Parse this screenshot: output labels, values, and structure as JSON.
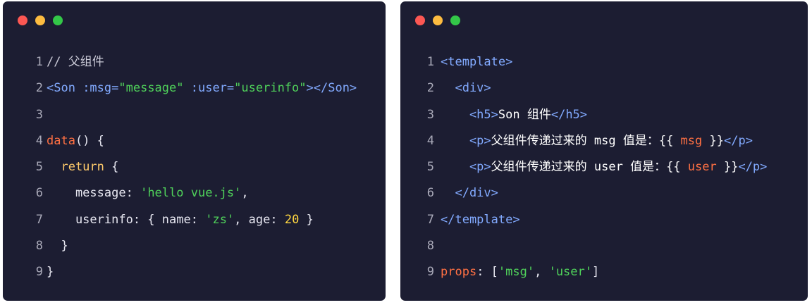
{
  "left_window": {
    "lines": [
      {
        "n": "1",
        "tokens": [
          {
            "t": "// 父组件",
            "c": "c-comment"
          }
        ]
      },
      {
        "n": "2",
        "tokens": [
          {
            "t": "<Son",
            "c": "c-tag"
          },
          {
            "t": " :msg=",
            "c": "c-attr"
          },
          {
            "t": "\"message\"",
            "c": "c-str"
          },
          {
            "t": " :user=",
            "c": "c-attr"
          },
          {
            "t": "\"userinfo\"",
            "c": "c-str"
          },
          {
            "t": "></Son>",
            "c": "c-tag"
          }
        ]
      },
      {
        "n": "3",
        "tokens": []
      },
      {
        "n": "4",
        "tokens": [
          {
            "t": "data",
            "c": "c-fn"
          },
          {
            "t": "() {",
            "c": "c-punc"
          }
        ]
      },
      {
        "n": "5",
        "tokens": [
          {
            "t": "  return",
            "c": "c-kw"
          },
          {
            "t": " {",
            "c": "c-punc"
          }
        ]
      },
      {
        "n": "6",
        "tokens": [
          {
            "t": "    message",
            "c": "c-prop"
          },
          {
            "t": ": ",
            "c": "c-punc"
          },
          {
            "t": "'hello vue.js'",
            "c": "c-str"
          },
          {
            "t": ",",
            "c": "c-punc"
          }
        ]
      },
      {
        "n": "7",
        "tokens": [
          {
            "t": "    userinfo",
            "c": "c-prop"
          },
          {
            "t": ": { ",
            "c": "c-punc"
          },
          {
            "t": "name",
            "c": "c-prop"
          },
          {
            "t": ": ",
            "c": "c-punc"
          },
          {
            "t": "'zs'",
            "c": "c-str"
          },
          {
            "t": ", ",
            "c": "c-punc"
          },
          {
            "t": "age",
            "c": "c-prop"
          },
          {
            "t": ": ",
            "c": "c-punc"
          },
          {
            "t": "20",
            "c": "c-num"
          },
          {
            "t": " }",
            "c": "c-punc"
          }
        ]
      },
      {
        "n": "8",
        "tokens": [
          {
            "t": "  }",
            "c": "c-punc"
          }
        ]
      },
      {
        "n": "9",
        "tokens": [
          {
            "t": "}",
            "c": "c-punc"
          }
        ]
      }
    ]
  },
  "right_window": {
    "lines": [
      {
        "n": "1",
        "tokens": [
          {
            "t": "<template>",
            "c": "c-tag"
          }
        ]
      },
      {
        "n": "2",
        "tokens": [
          {
            "t": "  <div>",
            "c": "c-tag"
          }
        ]
      },
      {
        "n": "3",
        "tokens": [
          {
            "t": "    <h5>",
            "c": "c-tag"
          },
          {
            "t": "Son 组件",
            "c": "c-text"
          },
          {
            "t": "</h5>",
            "c": "c-tag"
          }
        ]
      },
      {
        "n": "4",
        "tokens": [
          {
            "t": "    <p>",
            "c": "c-tag"
          },
          {
            "t": "父组件传递过来的 msg 值是：{{ ",
            "c": "c-text"
          },
          {
            "t": "msg",
            "c": "c-orange"
          },
          {
            "t": " }}",
            "c": "c-text"
          },
          {
            "t": "</p>",
            "c": "c-tag"
          }
        ]
      },
      {
        "n": "5",
        "tokens": [
          {
            "t": "    <p>",
            "c": "c-tag"
          },
          {
            "t": "父组件传递过来的 user 值是：{{ ",
            "c": "c-text"
          },
          {
            "t": "user",
            "c": "c-orange"
          },
          {
            "t": " }}",
            "c": "c-text"
          },
          {
            "t": "</p>",
            "c": "c-tag"
          }
        ]
      },
      {
        "n": "6",
        "tokens": [
          {
            "t": "  </div>",
            "c": "c-tag"
          }
        ]
      },
      {
        "n": "7",
        "tokens": [
          {
            "t": "</template>",
            "c": "c-tag"
          }
        ]
      },
      {
        "n": "8",
        "tokens": []
      },
      {
        "n": "9",
        "tokens": [
          {
            "t": "props",
            "c": "c-orange"
          },
          {
            "t": ": [",
            "c": "c-punc"
          },
          {
            "t": "'msg'",
            "c": "c-str"
          },
          {
            "t": ", ",
            "c": "c-punc"
          },
          {
            "t": "'user'",
            "c": "c-str"
          },
          {
            "t": "]",
            "c": "c-punc"
          }
        ]
      }
    ]
  },
  "colors": {
    "window_bg": "#1c1d32",
    "close": "#fc5753",
    "minimize": "#fdbc40",
    "maximize": "#33c748"
  }
}
